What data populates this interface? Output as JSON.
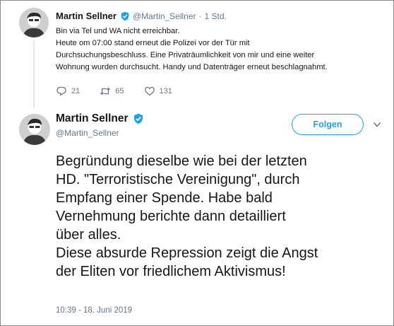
{
  "parent_tweet": {
    "author_name": "Martin Sellner",
    "author_handle": "@Martin_Sellner",
    "time": "1 Std.",
    "separator": "·",
    "lines": [
      "Bin via Tel und WA nicht erreichbar.",
      "Heute om 07:00 stand erneut die Polizei vor der Tür mit",
      "Durchsuchungsbeschluss. Eine Privaträumlichkeit von mir und eine weiter",
      "Wohnung wurden durchsucht. Handy und Datenträger erneut beschlagnahmt."
    ],
    "actions": {
      "replies": "21",
      "retweets": "65",
      "likes": "131"
    }
  },
  "main_tweet": {
    "author_name": "Martin Sellner",
    "author_handle": "@Martin_Sellner",
    "follow_label": "Folgen",
    "lines": [
      "Begründung dieselbe wie bei der letzten",
      "HD. \"Terroristische Vereinigung\", durch",
      "Empfang einer Spende. Habe bald",
      "Vernehmung berichte dann detailliert",
      "über alles.",
      "Diese absurde Repression zeigt die Angst",
      "der Eliten vor friedlichem Aktivismus!"
    ],
    "timestamp": "10:39 - 18. Juni 2019"
  },
  "icons": {
    "verified": "verified-badge-icon",
    "reply": "reply-icon",
    "retweet": "retweet-icon",
    "like": "heart-icon",
    "menu": "chevron-down-icon"
  },
  "colors": {
    "accent": "#1da1f2",
    "secondary_text": "#657786",
    "primary_text": "#14171a"
  }
}
